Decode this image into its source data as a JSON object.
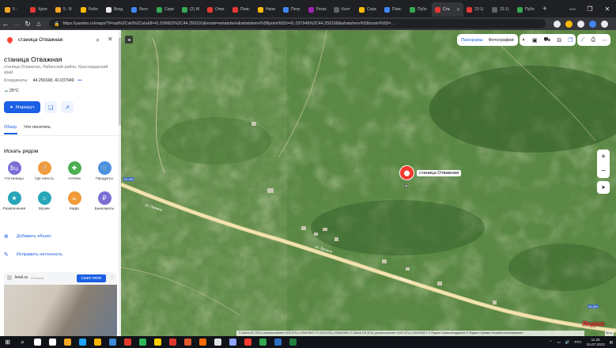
{
  "browser": {
    "tabs": [
      {
        "label": "5 - ",
        "color": "#f5a623"
      },
      {
        "label": "Хрон",
        "color": "#e53935"
      },
      {
        "label": "5 - В",
        "color": "#f5a623"
      },
      {
        "label": "Рабо",
        "color": "#fbbc04"
      },
      {
        "label": "Вход",
        "color": "#e8eaed"
      },
      {
        "label": "Лент",
        "color": "#4285f4"
      },
      {
        "label": "Серв",
        "color": "#34a853"
      },
      {
        "label": "(2) W",
        "color": "#34a853"
      },
      {
        "label": "Отве",
        "color": "#e53935"
      },
      {
        "label": "Поис",
        "color": "#e53935"
      },
      {
        "label": "Напи",
        "color": "#fbbc04"
      },
      {
        "label": "Петр",
        "color": "#4285f4"
      },
      {
        "label": "Регис",
        "color": "#9c27b0"
      },
      {
        "label": "Конт",
        "color": "#5f6368"
      },
      {
        "label": "Серв",
        "color": "#fbbc04"
      },
      {
        "label": "Поис",
        "color": "#4285f4"
      },
      {
        "label": "Публ",
        "color": "#34a853"
      },
      {
        "label": "Ста",
        "color": "#e53935",
        "active": true
      },
      {
        "label": "23:1(",
        "color": "#e53935"
      },
      {
        "label": "23:1(",
        "color": "#5f6368"
      },
      {
        "label": "Публ",
        "color": "#34a853"
      }
    ],
    "url": "https://yandex.ru/maps/?ll=sat%2Cskl%2Cstv&ll=41.036603%2C44.250191&mode=whatshere&whatshere%5Bpoint%5D=41.037949%2C44.250168&whatshere%5Bzoom%5D=..."
  },
  "sidebar": {
    "search_value": "станица Отважная",
    "place_title": "станица Отважная",
    "place_subtitle": "станица Отважная, Лабинский район, Краснодарский край",
    "coords_label": "Координаты:",
    "coords_value": "44.250168, 41.037949",
    "weather": "25°C",
    "route_label": "Маршрут",
    "tabs": [
      "Обзор",
      "Что посетить"
    ],
    "nearby_title": "Искать рядом",
    "categories": [
      {
        "label": "Гостиницы",
        "color": "#7b6fd6",
        "glyph": "🛏"
      },
      {
        "label": "Где поесть",
        "color": "#f29a38",
        "glyph": "🍴"
      },
      {
        "label": "Аптеки",
        "color": "#4caf50",
        "glyph": "✚"
      },
      {
        "label": "Продукты",
        "color": "#4a90e2",
        "glyph": "🛒"
      },
      {
        "label": "Развлечения",
        "color": "#26a6b8",
        "glyph": "★"
      },
      {
        "label": "Музеи",
        "color": "#26a6b8",
        "glyph": "⌂"
      },
      {
        "label": "Кафе",
        "color": "#f29a38",
        "glyph": "☕"
      },
      {
        "label": "Банкоматы",
        "color": "#7b6fd6",
        "glyph": "₽"
      }
    ],
    "actions": [
      {
        "label": "Добавить объект",
        "glyph": "⊕"
      },
      {
        "label": "Исправить неточность",
        "glyph": "✎"
      }
    ],
    "ad": {
      "site": "level.ru",
      "tag": "Реклама",
      "button": "Learn more"
    }
  },
  "map": {
    "layer_tabs": [
      "Панорамы",
      "Фотографии"
    ],
    "marker_label": "станица Отважная",
    "road_label_1": "ул. Ленина",
    "road_label_2": "ул. Ленина",
    "road_label_3": "ул. Ленина",
    "highway_badge_1": "04-001",
    "highway_badge_2": "04-001",
    "attribution": "© Airbus DS 2019, распространяет ООО ИТЦ «СКАНЭКС» © ООО ИТЦ «СКАНЭКС» © Airbus DS 2015, распространяет ООО ИТЦ «СКАНЭКС» © Яндекс   Правообладатели   © Яндекс   Справка   Условия использования",
    "scale": "50 м",
    "logo": "Яндекс"
  },
  "taskbar": {
    "icons": [
      "#ffffff",
      "#ffffff",
      "#f5a623",
      "#1fa3ff",
      "#f5b400",
      "#3c8cdb",
      "#e03a2e",
      "#2eb85c",
      "#ffd000",
      "#e03a2e",
      "#e05a2e",
      "#ff6a00",
      "#e0e0e0",
      "#8fa4ff",
      "#ff3b30",
      "#33a852",
      "#2b71c4",
      "#1e7f3c"
    ],
    "lang": "РУС",
    "time": "11:25",
    "date": "25.07.2023"
  }
}
